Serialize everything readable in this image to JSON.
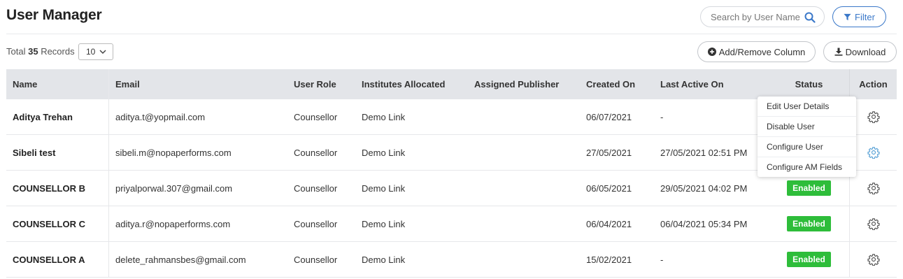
{
  "page": {
    "title": "User Manager"
  },
  "search": {
    "placeholder": "Search by User Name"
  },
  "filter": {
    "label": "Filter"
  },
  "records": {
    "prefix": "Total",
    "count": "35",
    "suffix": "Records"
  },
  "page_size": {
    "value": "10"
  },
  "toolbar": {
    "add_remove_column": "Add/Remove Column",
    "download": "Download"
  },
  "table": {
    "headers": [
      "Name",
      "Email",
      "User Role",
      "Institutes Allocated",
      "Assigned Publisher",
      "Created On",
      "Last Active On",
      "Status",
      "Action"
    ],
    "rows": [
      {
        "name": "Aditya Trehan",
        "email": "aditya.t@yopmail.com",
        "role": "Counsellor",
        "institutes": "Demo Link",
        "publisher": "",
        "created": "06/07/2021",
        "last_active": "-",
        "status": ""
      },
      {
        "name": "Sibeli test",
        "email": "sibeli.m@nopaperforms.com",
        "role": "Counsellor",
        "institutes": "Demo Link",
        "publisher": "",
        "created": "27/05/2021",
        "last_active": "27/05/2021 02:51 PM",
        "status": ""
      },
      {
        "name": "COUNSELLOR B",
        "email": "priyalporwal.307@gmail.com",
        "role": "Counsellor",
        "institutes": "Demo Link",
        "publisher": "",
        "created": "06/05/2021",
        "last_active": "29/05/2021 04:02 PM",
        "status": "Enabled"
      },
      {
        "name": "COUNSELLOR C",
        "email": "aditya.r@nopaperforms.com",
        "role": "Counsellor",
        "institutes": "Demo Link",
        "publisher": "",
        "created": "06/04/2021",
        "last_active": "06/04/2021 05:34 PM",
        "status": "Enabled"
      },
      {
        "name": "COUNSELLOR A",
        "email": "delete_rahmansbes@gmail.com",
        "role": "Counsellor",
        "institutes": "Demo Link",
        "publisher": "",
        "created": "15/02/2021",
        "last_active": "-",
        "status": "Enabled"
      }
    ]
  },
  "action_menu": {
    "items": [
      "Edit User Details",
      "Disable User",
      "Configure User",
      "Configure AM Fields"
    ]
  },
  "colors": {
    "accent": "#3a78c9",
    "enabled_badge": "#2ebd3a",
    "header_bg": "#e3e5e9",
    "active_gear": "#5aa2d6"
  },
  "icons": {
    "search": "search-icon",
    "filter": "filter-icon",
    "add": "plus-circle-icon",
    "download": "download-icon",
    "chevron": "chevron-down-icon",
    "action": "gear-icon"
  }
}
